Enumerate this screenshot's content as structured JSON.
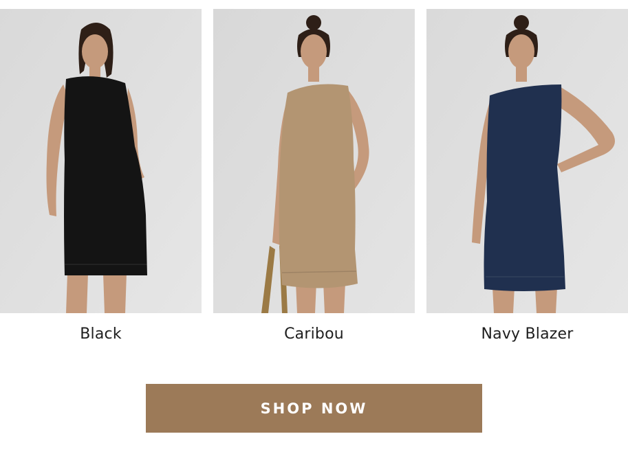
{
  "products": [
    {
      "color_name": "Black",
      "dress_color": "#141414"
    },
    {
      "color_name": "Caribou",
      "dress_color": "#b39572"
    },
    {
      "color_name": "Navy Blazer",
      "dress_color": "#20304f"
    }
  ],
  "cta": {
    "label": "SHOP NOW",
    "background": "#9c7a58"
  },
  "colors": {
    "photo_background": "#dcdcdc",
    "skin": "#c59a7c",
    "hair": "#2e1f17"
  }
}
